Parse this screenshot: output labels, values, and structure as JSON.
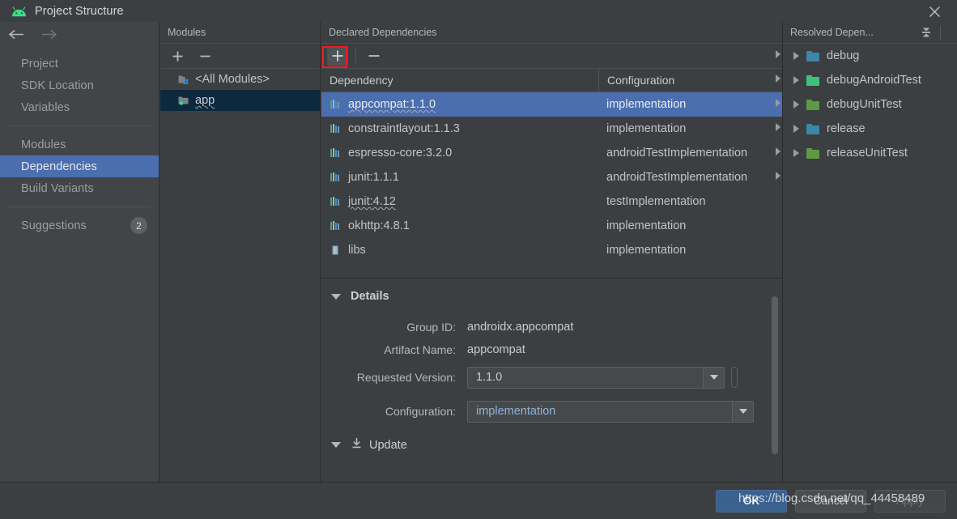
{
  "window": {
    "title": "Project Structure",
    "app_icon": "android-icon",
    "close_icon": "close-icon"
  },
  "nav": {
    "back_icon": "arrow-left-icon",
    "forward_icon": "arrow-right-icon",
    "groups": [
      {
        "items": [
          {
            "label": "Project",
            "selected": false
          },
          {
            "label": "SDK Location",
            "selected": false
          },
          {
            "label": "Variables",
            "selected": false
          }
        ]
      },
      {
        "items": [
          {
            "label": "Modules",
            "selected": false
          },
          {
            "label": "Dependencies",
            "selected": true
          },
          {
            "label": "Build Variants",
            "selected": false
          }
        ]
      },
      {
        "items": [
          {
            "label": "Suggestions",
            "selected": false,
            "badge": "2"
          }
        ]
      }
    ]
  },
  "modules": {
    "title": "Modules",
    "minimize_icon": "minimize-icon",
    "add_icon": "plus-icon",
    "remove_icon": "minus-icon",
    "tree": [
      {
        "label": "<All Modules>",
        "icon": "all-modules-icon",
        "selected": false,
        "wavy": false
      },
      {
        "label": "app",
        "icon": "module-folder-icon",
        "selected": true,
        "wavy": true
      }
    ]
  },
  "declared": {
    "title": "Declared Dependencies",
    "add_icon": "plus-icon",
    "remove_icon": "minus-icon",
    "add_highlighted": true,
    "columns": [
      "Dependency",
      "Configuration"
    ],
    "rows": [
      {
        "dependency": "appcompat:1.1.0",
        "configuration": "implementation",
        "icon": "library-icon",
        "selected": true,
        "wavy": true
      },
      {
        "dependency": "constraintlayout:1.1.3",
        "configuration": "implementation",
        "icon": "library-icon",
        "selected": false,
        "wavy": false
      },
      {
        "dependency": "espresso-core:3.2.0",
        "configuration": "androidTestImplementation",
        "icon": "library-icon",
        "selected": false,
        "wavy": false
      },
      {
        "dependency": "junit:1.1.1",
        "configuration": "androidTestImplementation",
        "icon": "library-icon",
        "selected": false,
        "wavy": false
      },
      {
        "dependency": "junit:4.12",
        "configuration": "testImplementation",
        "icon": "library-icon",
        "selected": false,
        "wavy": true
      },
      {
        "dependency": "okhttp:4.8.1",
        "configuration": "implementation",
        "icon": "library-icon",
        "selected": false,
        "wavy": false
      },
      {
        "dependency": "libs",
        "configuration": "implementation",
        "icon": "jar-file-icon",
        "selected": false,
        "wavy": false
      }
    ]
  },
  "details": {
    "title": "Details",
    "expand_icon": "triangle-down-icon",
    "group_id_label": "Group ID:",
    "group_id_value": "androidx.appcompat",
    "artifact_label": "Artifact Name:",
    "artifact_value": "appcompat",
    "version_label": "Requested Version:",
    "version_value": "1.1.0",
    "configuration_label": "Configuration:",
    "configuration_value": "implementation",
    "update_label": "Update",
    "update_icon": "download-icon",
    "dropdown_icon": "chevron-down-icon"
  },
  "resolved": {
    "title": "Resolved Depen...",
    "collapse_icon": "collapse-all-icon",
    "minimize_icon": "minimize-icon",
    "expand_icon": "triangle-right-icon",
    "rows": [
      {
        "label": "debug",
        "icon": "folder-icon",
        "color": "#3b87a8"
      },
      {
        "label": "debugAndroidTest",
        "icon": "folder-icon",
        "color": "#3dc27a"
      },
      {
        "label": "debugUnitTest",
        "icon": "folder-icon",
        "color": "#5d9a44"
      },
      {
        "label": "release",
        "icon": "folder-icon",
        "color": "#3b87a8"
      },
      {
        "label": "releaseUnitTest",
        "icon": "folder-icon",
        "color": "#5d9a44"
      }
    ]
  },
  "footer": {
    "ok_label": "OK",
    "cancel_label": "Cancel",
    "apply_label": "Apply"
  },
  "watermark": {
    "text": "https://blog.csdn.net/qq_44458489"
  },
  "colors": {
    "accent_selection": "#4b6eaf",
    "inactive_selection": "#0d293e",
    "annotation_red": "#ee1c25",
    "panel_bg": "#3c3f41",
    "nav_bg": "#414548"
  }
}
